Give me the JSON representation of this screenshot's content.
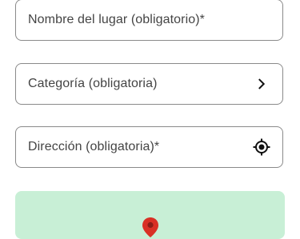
{
  "form": {
    "name_field": {
      "label": "Nombre del lugar (obligatorio)*"
    },
    "category_field": {
      "label": "Categoría (obligatoria)",
      "icon": "chevron-right-icon"
    },
    "address_field": {
      "label": "Dirección (obligatoria)*",
      "icon": "my-location-icon"
    }
  },
  "map_preview": {
    "background_color": "#c8efd6",
    "marker_icon": "map-pin-icon",
    "marker_color": "#d93025"
  }
}
